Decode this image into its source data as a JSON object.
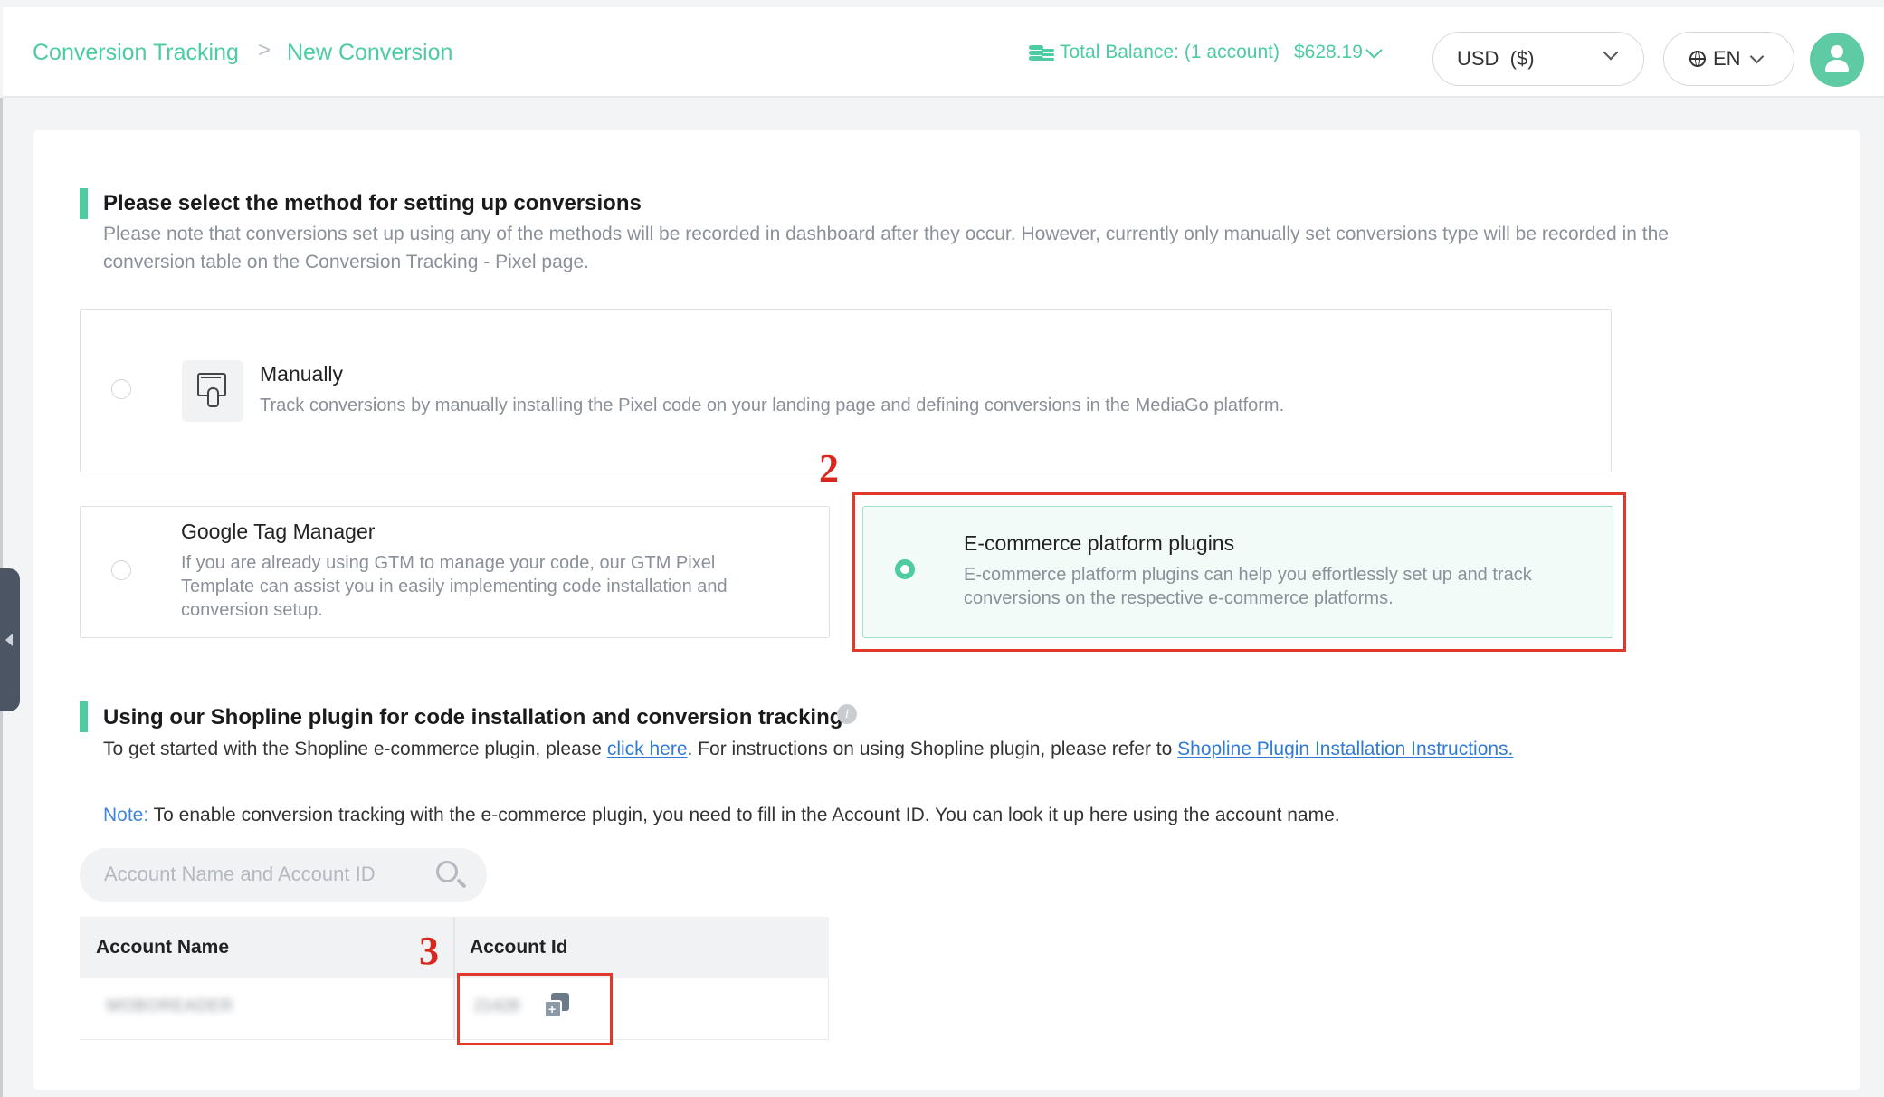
{
  "header": {
    "breadcrumb": {
      "root": "Conversion Tracking",
      "separator": ">",
      "current": "New Conversion"
    },
    "balance": {
      "label": "Total Balance:",
      "accounts": "(1 account)",
      "amount": "$628.19",
      "icon": "coins-icon"
    },
    "currency_select": {
      "value": "USD  ($)"
    },
    "language_select": {
      "value": "EN",
      "icon": "globe-icon"
    },
    "avatar_icon": "user-icon"
  },
  "method_section": {
    "title": "Please select the method for setting up conversions",
    "description_line1": "Please note that conversions set up using any of the methods will be recorded in dashboard after they occur. However, currently only manually set conversions type will be recorded in the",
    "description_line2": "conversion table on the Conversion Tracking - Pixel page.",
    "options": [
      {
        "id": "manually",
        "title": "Manually",
        "description": "Track conversions by manually installing the Pixel code on your landing page and defining conversions in the MediaGo platform.",
        "selected": false,
        "icon": "pointer-screen-icon"
      },
      {
        "id": "gtm",
        "title": "Google Tag Manager",
        "description_lines": [
          "If you are already using GTM to manage your code, our GTM Pixel",
          "Template can assist you in easily implementing code installation and",
          "conversion setup."
        ],
        "selected": false
      },
      {
        "id": "ecommerce",
        "title": "E-commerce platform plugins",
        "description_lines": [
          "E-commerce platform plugins can help you effortlessly set up and track",
          "conversions on the respective e-commerce platforms."
        ],
        "selected": true
      }
    ]
  },
  "annotations": {
    "step2": "2",
    "step3": "3",
    "highlight_color": "#e0392b"
  },
  "plugin_section": {
    "title": "Using our Shopline plugin for code installation and conversion tracking",
    "intro_before_link": "To get started with the Shopline e-commerce plugin, please ",
    "click_here_link": "click here",
    "intro_middle": ". For instructions on using Shopline plugin, please refer to ",
    "instructions_link": "Shopline Plugin Installation Instructions.",
    "note_label": "Note:",
    "note_text": " To enable conversion tracking with the e-commerce plugin, you need to fill in the Account ID. You can look it up here using the account name.",
    "search": {
      "placeholder": "Account Name and Account ID",
      "icon": "search-icon"
    },
    "table": {
      "columns": [
        "Account Name",
        "Account Id"
      ],
      "rows": [
        {
          "name": "MOBOREADER",
          "id": "21428",
          "copy_icon": "copy-icon"
        }
      ]
    }
  },
  "colors": {
    "accent": "#4ccca0",
    "link": "#2e7ad6",
    "annotation": "#e0392b"
  }
}
